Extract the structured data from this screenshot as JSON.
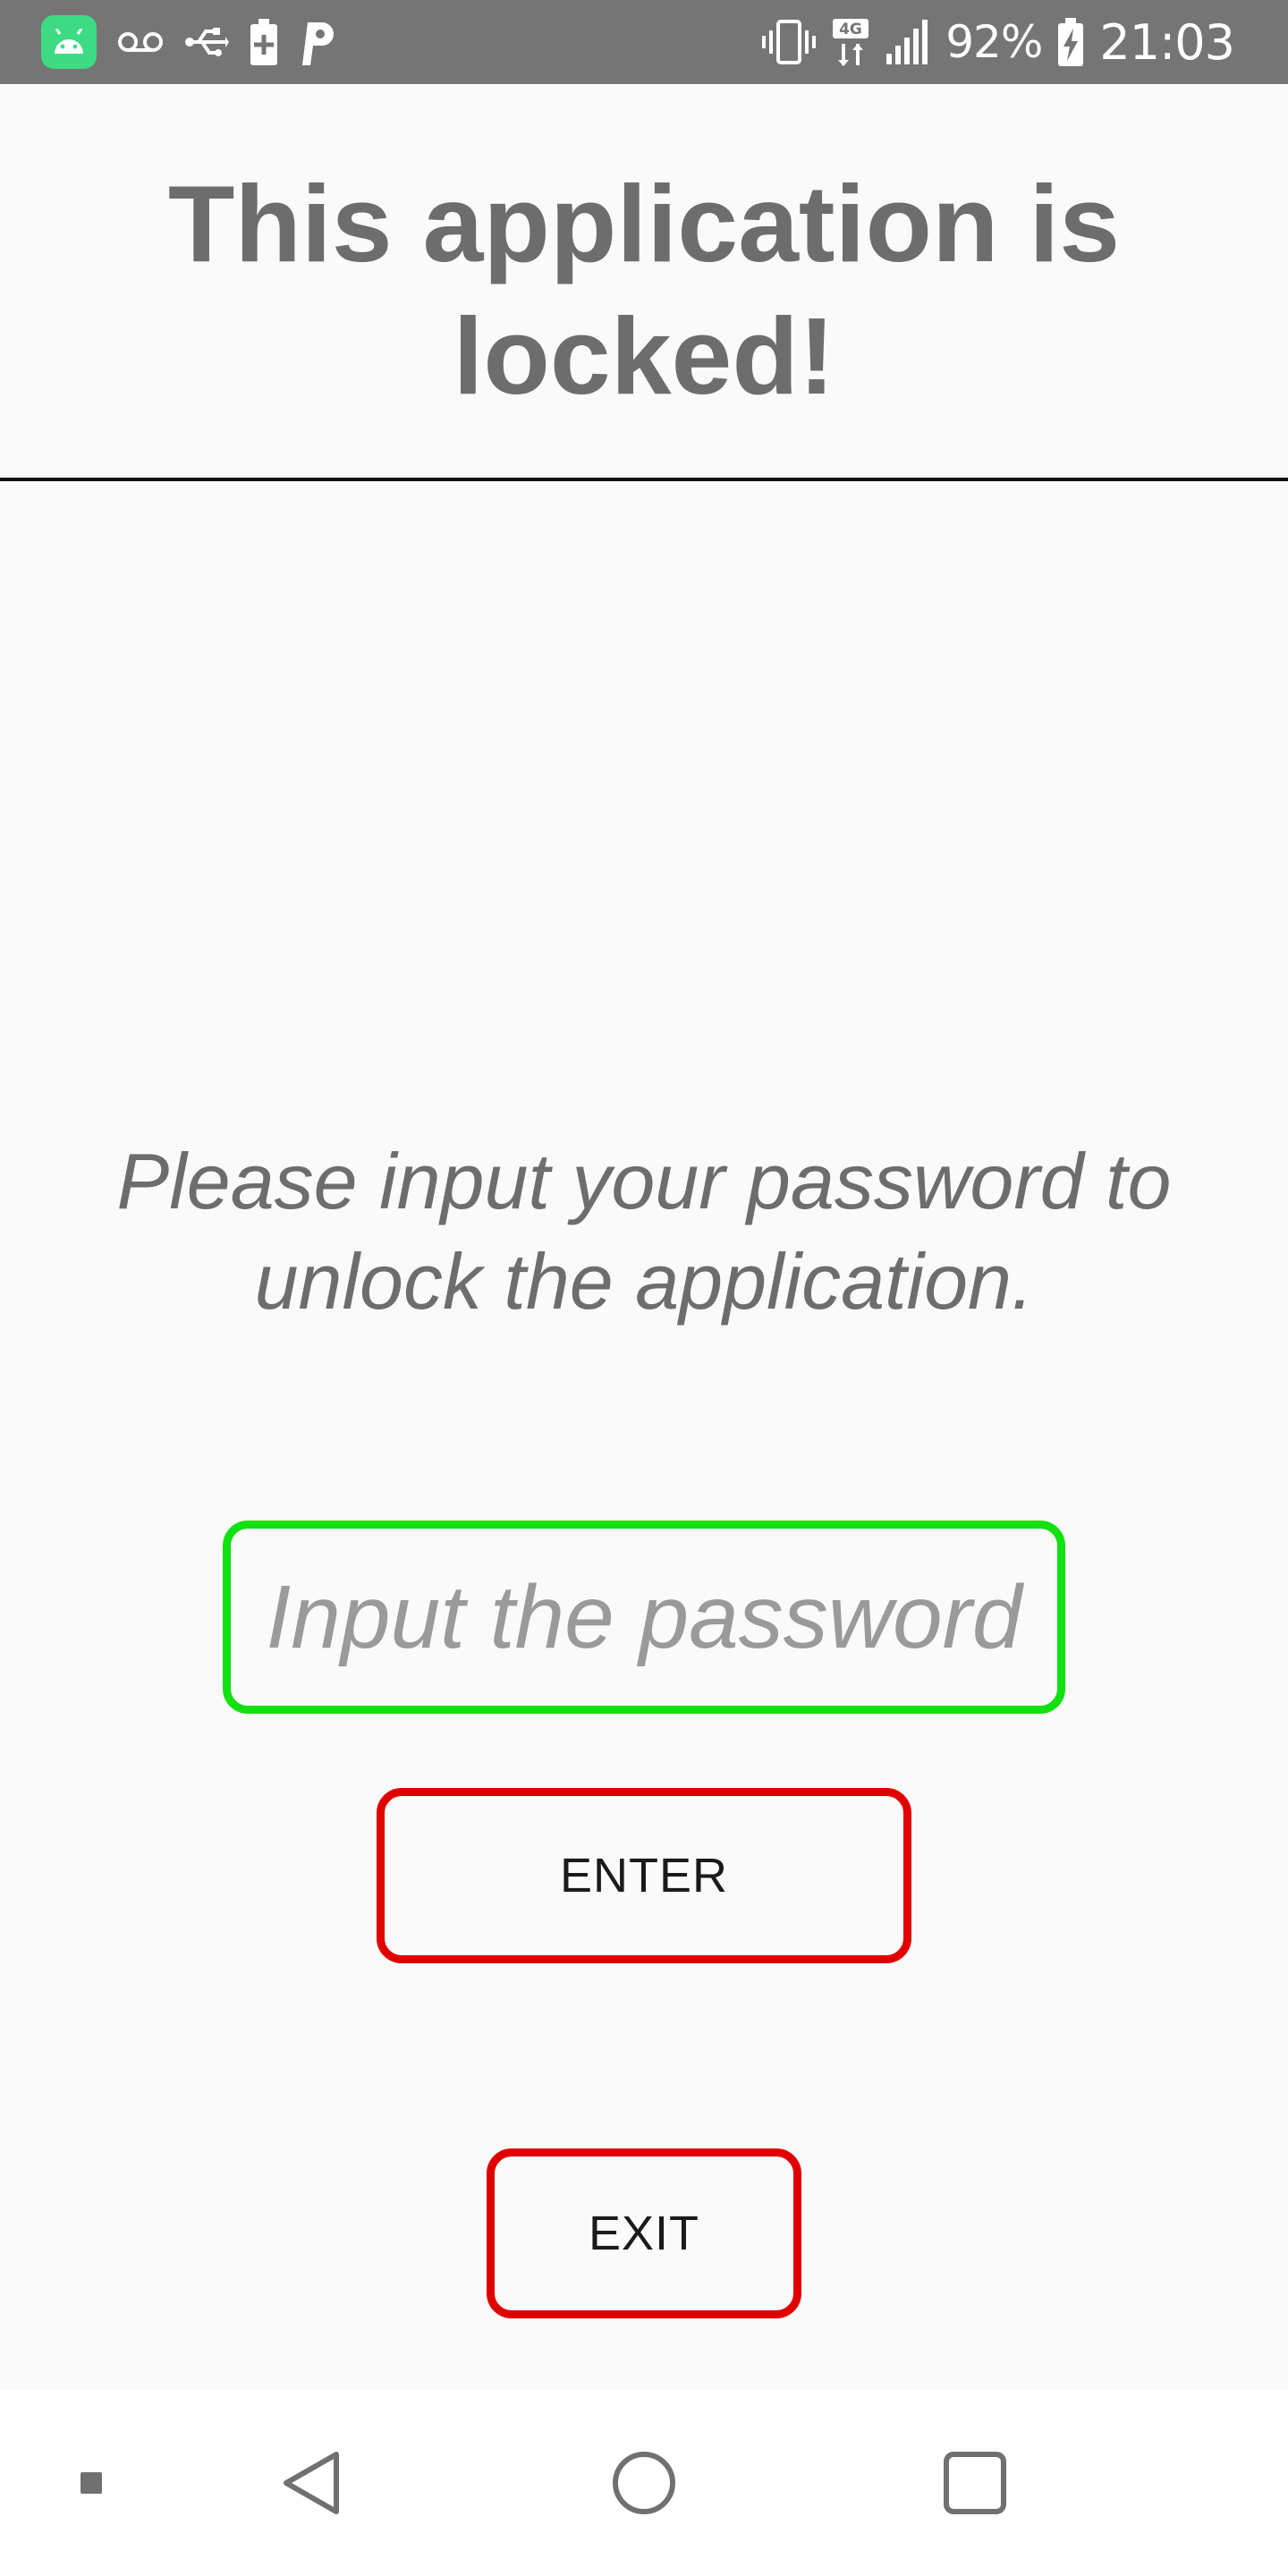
{
  "status_bar": {
    "battery_percent": "92%",
    "clock": "21:03",
    "network_type": "4G",
    "icons": [
      "android-app-icon",
      "voicemail-icon",
      "usb-icon",
      "battery-saver-icon",
      "parking-icon",
      "vibrate-icon",
      "network-4g-icon",
      "signal-icon",
      "battery-charging-icon"
    ]
  },
  "header": {
    "title": "This application is locked!"
  },
  "main": {
    "prompt": "Please input your password to unlock the application.",
    "password_placeholder": "Input the password",
    "password_value": "",
    "enter_label": "ENTER",
    "exit_label": "EXIT"
  },
  "nav_bar": {
    "icons": [
      "small-square-icon",
      "back-icon",
      "home-icon",
      "recents-icon"
    ]
  },
  "colors": {
    "status_bar_bg": "#757575",
    "page_bg": "#fafafa",
    "input_border": "#11e011",
    "button_border": "#e00000",
    "title_text": "#6d6d6d"
  }
}
